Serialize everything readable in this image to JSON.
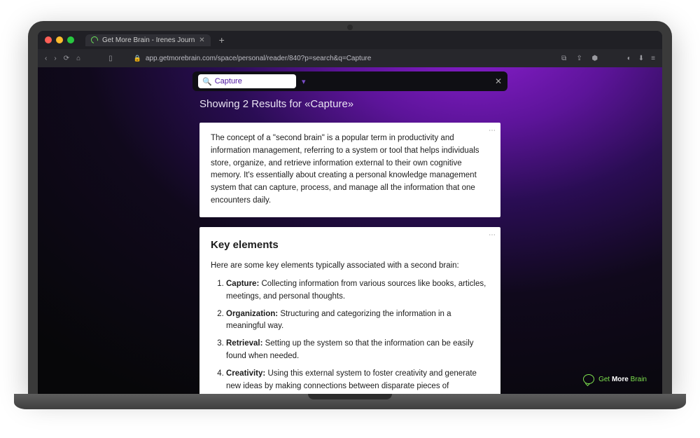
{
  "browser": {
    "tab_title": "Get More Brain - Irenes Journ",
    "url": "app.getmorebrain.com/space/personal/reader/840?p=search&q=Capture"
  },
  "search": {
    "query": "Capture",
    "results_heading": "Showing 2 Results for «Capture»"
  },
  "cards": {
    "intro_text": "The concept of a \"second brain\" is a popular term in productivity and information management, referring to a system or tool that helps individuals store, organize, and retrieve information external to their own cognitive memory. It's essentially about creating a personal knowledge management system that can capture, process, and manage all the information that one encounters daily.",
    "second": {
      "heading": "Key elements",
      "intro": "Here are some key elements typically associated with a second brain:",
      "items": [
        {
          "label": "Capture:",
          "text": " Collecting information from various sources like books, articles, meetings, and personal thoughts."
        },
        {
          "label": "Organization:",
          "text": " Structuring and categorizing the information in a meaningful way."
        },
        {
          "label": "Retrieval:",
          "text": " Setting up the system so that the information can be easily found when needed."
        },
        {
          "label": "Creativity:",
          "text": " Using this external system to foster creativity and generate new ideas by making connections between disparate pieces of information."
        }
      ]
    }
  },
  "brand": {
    "prefix": "Get ",
    "bold": "More",
    "suffix": " Brain"
  }
}
